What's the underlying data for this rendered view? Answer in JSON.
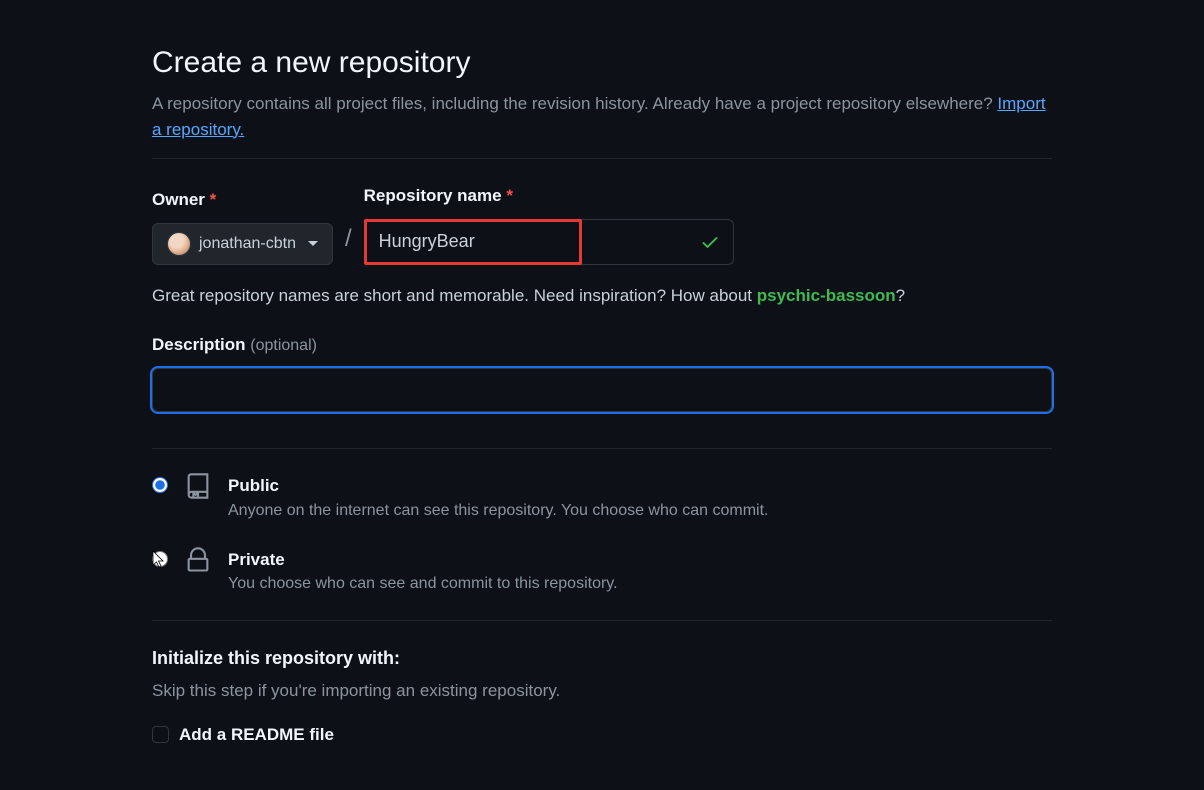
{
  "page": {
    "title": "Create a new repository",
    "subtitle_prefix": "A repository contains all project files, including the revision history. Already have a project repository elsewhere? ",
    "import_link": "Import a repository."
  },
  "owner": {
    "label": "Owner",
    "username": "jonathan-cbtn"
  },
  "repo": {
    "label": "Repository name",
    "value": "HungryBear",
    "hint_prefix": "Great repository names are short and memorable. Need inspiration? How about ",
    "suggestion": "psychic-bassoon",
    "hint_suffix": "?"
  },
  "description": {
    "label": "Description ",
    "optional": "(optional)",
    "value": ""
  },
  "visibility": {
    "public": {
      "title": "Public",
      "sub": "Anyone on the internet can see this repository. You choose who can commit."
    },
    "private": {
      "title": "Private",
      "sub": "You choose who can see and commit to this repository."
    }
  },
  "init": {
    "header": "Initialize this repository with:",
    "sub": "Skip this step if you're importing an existing repository.",
    "readme_label": "Add a README file"
  }
}
